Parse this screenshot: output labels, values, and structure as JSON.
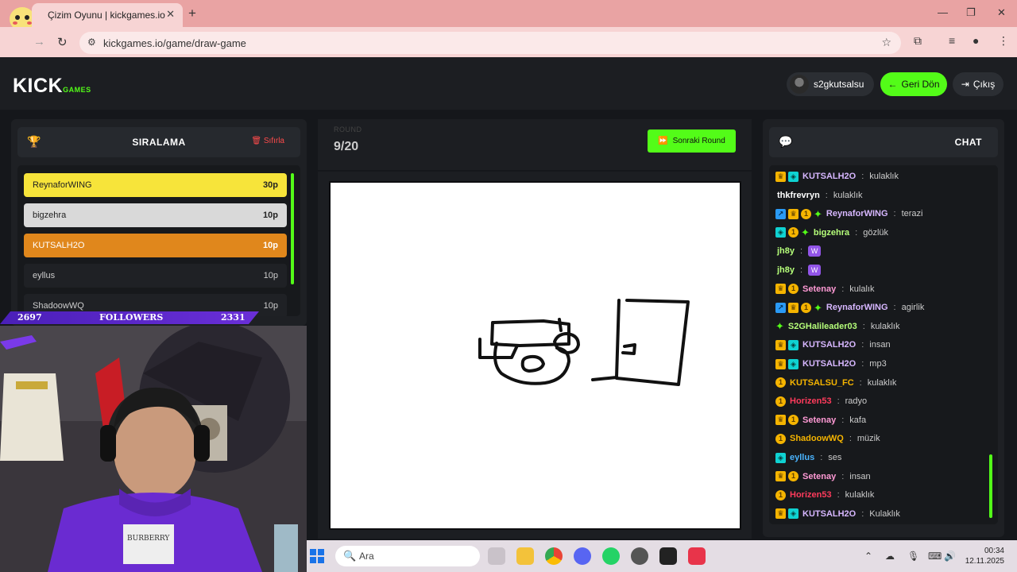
{
  "browser": {
    "tab_title": "Çizim Oyunu | kickgames.io",
    "tab_close": "✕",
    "new_tab": "+",
    "url": "kickgames.io/game/draw-game",
    "window_controls": [
      "—",
      "❐",
      "✕"
    ]
  },
  "header": {
    "logo_part1": "KICK",
    "logo_part2": "GAMES",
    "username": "s2gkutsalsu",
    "back_label": "Geri Dön",
    "exit_label": "Çıkış",
    "accent": "#53fc18"
  },
  "ranking": {
    "title": "SIRALAMA",
    "reset_label": "Sıfırla",
    "rows": [
      {
        "name": "ReynaforWING",
        "points": "30p"
      },
      {
        "name": "bigzehra",
        "points": "10p"
      },
      {
        "name": "KUTSALH2O",
        "points": "10p"
      },
      {
        "name": "eyllus",
        "points": "10p"
      },
      {
        "name": "ShadoowWQ",
        "points": "10p"
      }
    ]
  },
  "overlay": {
    "followers_left": "2697",
    "followers_label": "FOLLOWERS",
    "followers_right": "2331"
  },
  "round": {
    "label": "ROUND",
    "value": "9/20",
    "next_label": "Sonraki Round"
  },
  "chat": {
    "title": "CHAT",
    "messages": [
      {
        "badges": [
          "crown",
          "verified"
        ],
        "user": "KUTSALH2O",
        "color": "#d7b7ff",
        "text": "kulaklık"
      },
      {
        "badges": [],
        "user": "thkfrevryn",
        "color": "#ffffff",
        "text": "kulaklık"
      },
      {
        "badges": [
          "pin",
          "crown",
          "coin",
          "star"
        ],
        "user": "ReynaforWING",
        "color": "#d7b7ff",
        "text": "terazi"
      },
      {
        "badges": [
          "verified",
          "coin",
          "star"
        ],
        "user": "bigzehra",
        "color": "#b6ff7a",
        "text": "gözlük"
      },
      {
        "badges": [],
        "user": "jh8y",
        "color": "#b6ff7a",
        "text": "W",
        "emote": true
      },
      {
        "badges": [],
        "user": "jh8y",
        "color": "#b6ff7a",
        "text": "W",
        "emote": true
      },
      {
        "badges": [
          "crown",
          "coin"
        ],
        "user": "Setenay",
        "color": "#ff9ad5",
        "text": "kulalık"
      },
      {
        "badges": [
          "pin",
          "crown",
          "coin",
          "star"
        ],
        "user": "ReynaforWING",
        "color": "#d7b7ff",
        "text": "agirlik"
      },
      {
        "badges": [
          "star"
        ],
        "user": "S2GHalileader03",
        "color": "#b6ff7a",
        "text": "kulaklık"
      },
      {
        "badges": [
          "crown",
          "verified"
        ],
        "user": "KUTSALH2O",
        "color": "#d7b7ff",
        "text": "insan"
      },
      {
        "badges": [
          "crown",
          "verified"
        ],
        "user": "KUTSALH2O",
        "color": "#d7b7ff",
        "text": "mp3"
      },
      {
        "badges": [
          "coin"
        ],
        "user": "KUTSALSU_FC",
        "color": "#f5b400",
        "text": "kulaklık"
      },
      {
        "badges": [
          "coin"
        ],
        "user": "Horizen53",
        "color": "#ff3b5c",
        "text": "radyo"
      },
      {
        "badges": [
          "crown",
          "coin"
        ],
        "user": "Setenay",
        "color": "#ff9ad5",
        "text": "kafa"
      },
      {
        "badges": [
          "coin"
        ],
        "user": "ShadoowWQ",
        "color": "#f5b400",
        "text": "müzik"
      },
      {
        "badges": [
          "verified"
        ],
        "user": "eyllus",
        "color": "#4ab4ff",
        "text": "ses"
      },
      {
        "badges": [
          "crown",
          "coin"
        ],
        "user": "Setenay",
        "color": "#ff9ad5",
        "text": "insan"
      },
      {
        "badges": [
          "coin"
        ],
        "user": "Horizen53",
        "color": "#ff3b5c",
        "text": "kulaklık"
      },
      {
        "badges": [
          "crown",
          "verified"
        ],
        "user": "KUTSALH2O",
        "color": "#d7b7ff",
        "text": "Kulaklık"
      }
    ]
  },
  "taskbar": {
    "search_placeholder": "Ara",
    "time": "00:34",
    "date": "12.11.2025"
  }
}
